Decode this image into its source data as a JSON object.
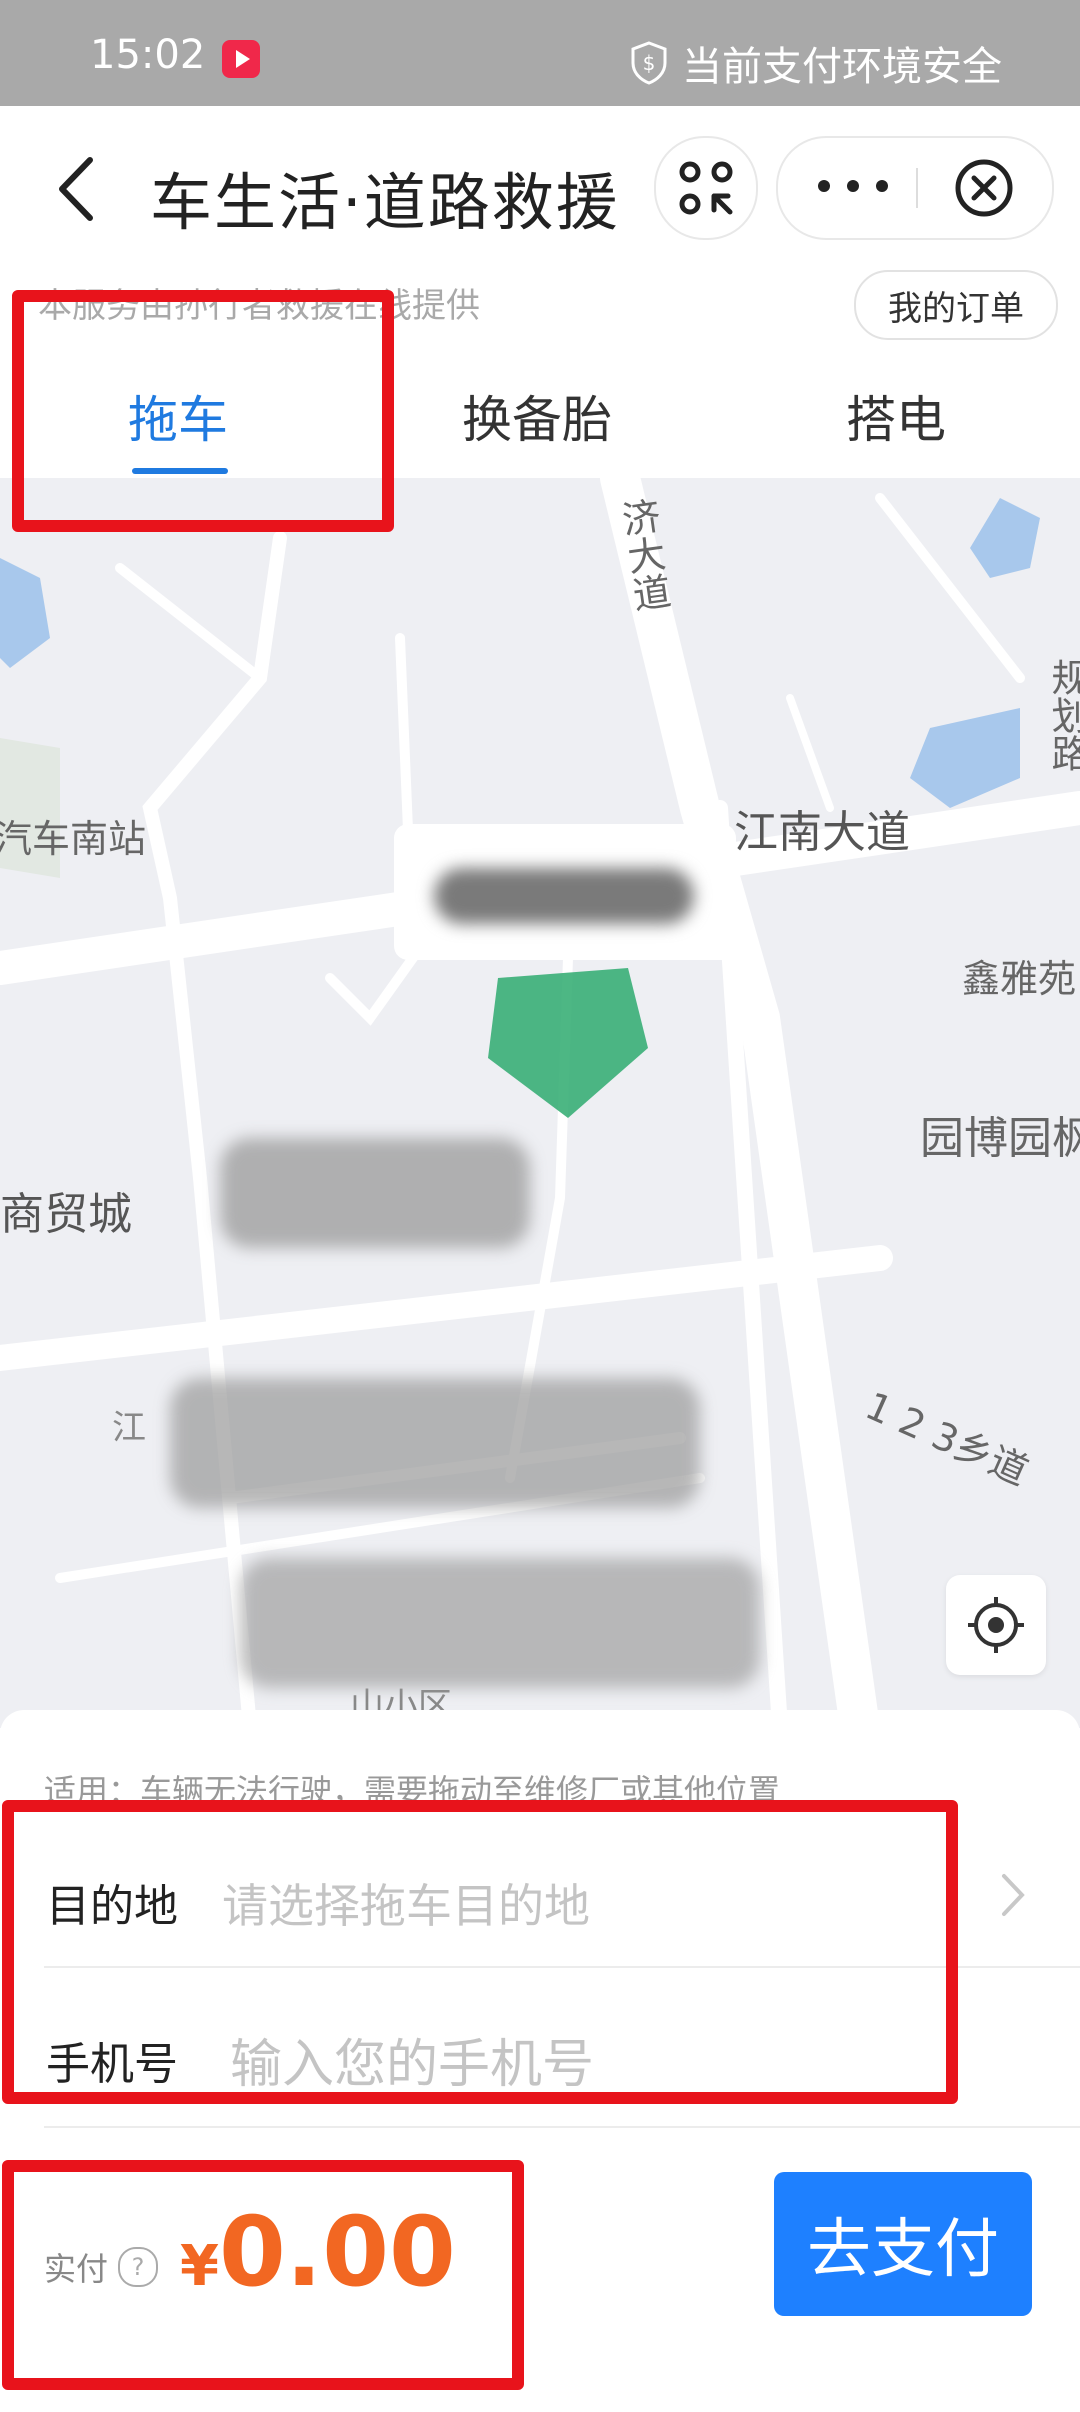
{
  "status_bar": {
    "time": "15:02",
    "secure_text": "当前支付环境安全"
  },
  "nav": {
    "title": "车生活·道路救援"
  },
  "provider_text": "本服务由孙行者救援在线提供",
  "orders_button": "我的订单",
  "tabs": [
    {
      "label": "拖车"
    },
    {
      "label": "换备胎"
    },
    {
      "label": "搭电"
    }
  ],
  "map": {
    "labels": {
      "road1": "济大道",
      "road2": "规划路",
      "station": "汽车南站",
      "avenue": "江南大道",
      "garden1": "鑫雅苑",
      "garden2": "园博园枫",
      "mall": "商贸城",
      "village_road": "1 2 3乡道",
      "jiang": "江",
      "district": "山小区"
    }
  },
  "sheet": {
    "hint": "适用：车辆无法行驶，需要拖动至维修厂或其他位置",
    "destination": {
      "label": "目的地",
      "placeholder": "请选择拖车目的地"
    },
    "phone": {
      "label": "手机号",
      "placeholder": "输入您的手机号"
    },
    "pay": {
      "label": "实付",
      "currency": "¥",
      "amount": "0.00",
      "button": "去支付"
    }
  },
  "colors": {
    "accent": "#1f7ae0",
    "pay_button": "#1e80ff",
    "amount": "#f26722",
    "annotation": "#e8131b"
  }
}
